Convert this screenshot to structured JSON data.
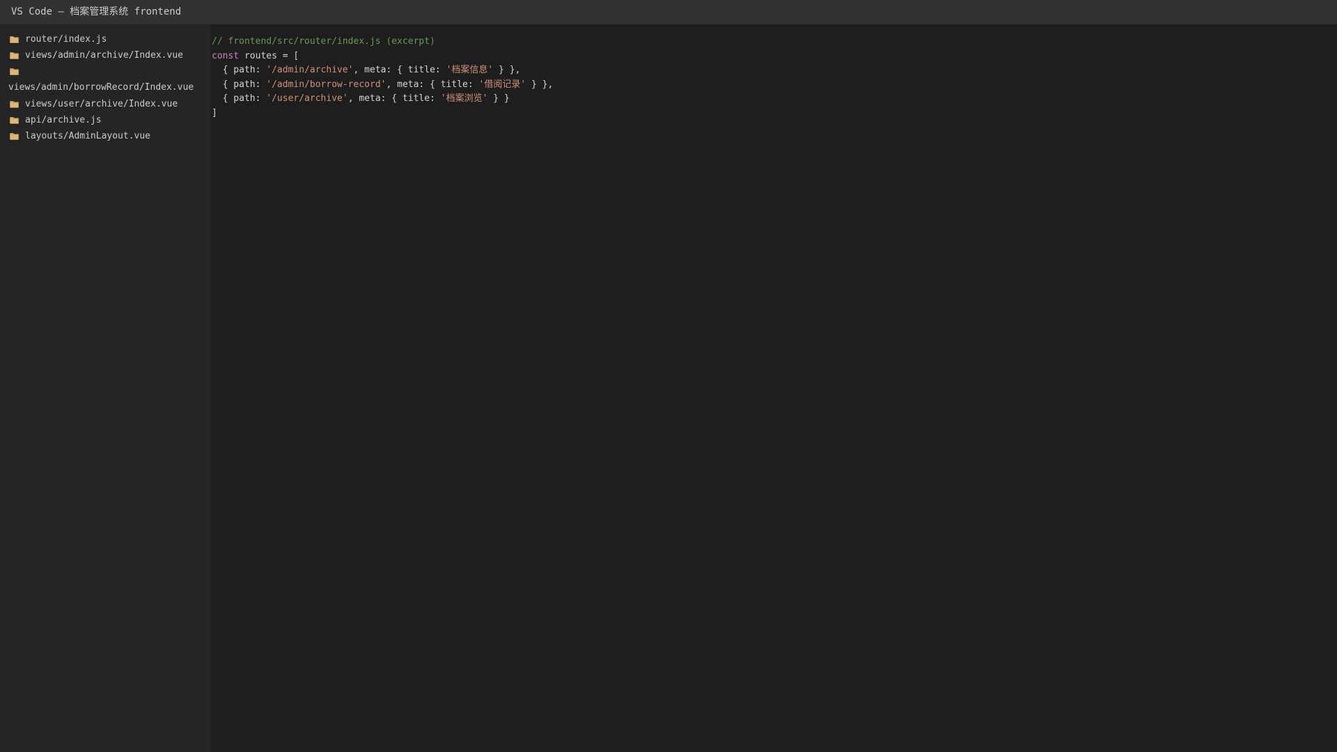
{
  "window": {
    "title": "VS Code — 档案管理系统 frontend"
  },
  "sidebar": {
    "items": [
      {
        "icon": "folder-icon",
        "label": "router/index.js"
      },
      {
        "icon": "folder-icon",
        "label": "views/admin/archive/Index.vue"
      },
      {
        "icon": "folder-icon",
        "label": "views/admin/borrowRecord/Index.vue"
      },
      {
        "icon": "folder-icon",
        "label": "views/user/archive/Index.vue"
      },
      {
        "icon": "folder-icon",
        "label": "api/archive.js"
      },
      {
        "icon": "folder-icon",
        "label": "layouts/AdminLayout.vue"
      }
    ]
  },
  "editor": {
    "lines": [
      {
        "t1": "// frontend/src/router/index.js (excerpt)"
      },
      {
        "t1": "const",
        "t2": " routes = ["
      },
      {
        "t1": "  { path: ",
        "t2": "'/admin/archive'",
        "t3": ", meta: { title: ",
        "t4": "'档案信息'",
        "t5": " } },"
      },
      {
        "t1": "  { path: ",
        "t2": "'/admin/borrow-record'",
        "t3": ", meta: { title: ",
        "t4": "'借阅记录'",
        "t5": " } },"
      },
      {
        "t1": "  { path: ",
        "t2": "'/user/archive'",
        "t3": ", meta: { title: ",
        "t4": "'档案浏览'",
        "t5": " } }"
      },
      {
        "t1": "]"
      }
    ]
  },
  "colors": {
    "titlebar": "#323233",
    "sidebar": "#252526",
    "editor": "#1e1e1e",
    "comment": "#6a9955",
    "keyword": "#c586c0",
    "string": "#ce9178",
    "text": "#d4d4d4",
    "folder": "#dcb67a"
  }
}
